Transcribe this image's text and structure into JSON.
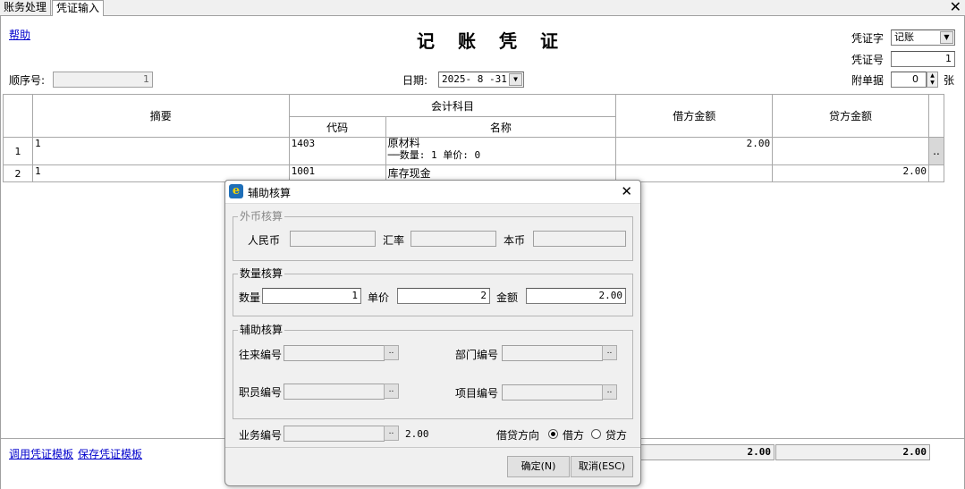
{
  "tabs": [
    {
      "label": "账务处理"
    },
    {
      "label": "凭证输入"
    }
  ],
  "close_glyph": "✕",
  "toolbar": {
    "help": "帮助"
  },
  "voucher": {
    "title_chars": [
      "记",
      "账",
      "凭",
      "证"
    ],
    "word_label": "凭证字",
    "word_value": "记账",
    "number_label": "凭证号",
    "number_value": "1",
    "seq_label": "顺序号:",
    "seq_value": "1",
    "date_label": "日期:",
    "date_value": "2025- 8 -31",
    "attach_label": "附单据",
    "attach_value": "0",
    "attach_unit": "张"
  },
  "grid": {
    "headers": {
      "summary": "摘要",
      "account": "会计科目",
      "code": "代码",
      "name": "名称",
      "debit": "借方金额",
      "credit": "贷方金额"
    },
    "rows": [
      {
        "no": "1",
        "summary": "1",
        "code": "1403",
        "name": "原材料",
        "name2": "──数量: 1 单价: 0",
        "debit": "2.00",
        "credit": ""
      },
      {
        "no": "2",
        "summary": "1",
        "code": "1001",
        "name": "库存现金",
        "name2": "",
        "debit": "",
        "credit": "2.00"
      }
    ],
    "row_button": "..",
    "total_debit": "2.00",
    "total_credit": "2.00"
  },
  "footer": {
    "load_template": "调用凭证模板",
    "save_template": "保存凭证模板"
  },
  "dialog": {
    "title": "辅助核算",
    "close": "✕",
    "foreign": {
      "legend": "外币核算",
      "rmb_label": "人民币",
      "rate_label": "汇率",
      "local_label": "本币",
      "rmb_value": "",
      "rate_value": "",
      "local_value": ""
    },
    "quantity": {
      "legend": "数量核算",
      "qty_label": "数量",
      "qty_value": "1",
      "price_label": "单价",
      "price_value": "2",
      "amount_label": "金额",
      "amount_value": "2.00"
    },
    "aux": {
      "legend": "辅助核算",
      "partner_label": "往来编号",
      "dept_label": "部门编号",
      "staff_label": "职员编号",
      "project_label": "项目编号"
    },
    "business_label": "业务编号",
    "business_amount": "2.00",
    "direction_label": "借贷方向",
    "direction_debit": "借方",
    "direction_credit": "贷方",
    "direction_selected": "借方",
    "ok_button": "确定(N)",
    "cancel_button": "取消(ESC)",
    "browse_button": ".."
  }
}
